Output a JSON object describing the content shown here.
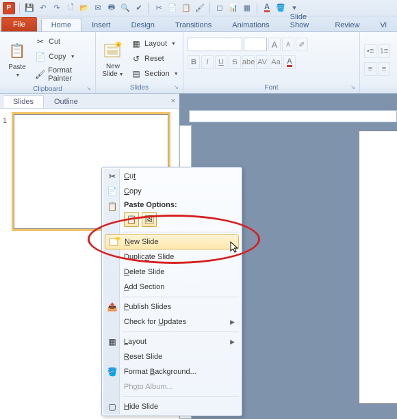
{
  "qat": {
    "app": "P"
  },
  "tabs": {
    "file": "File",
    "home": "Home",
    "insert": "Insert",
    "design": "Design",
    "transitions": "Transitions",
    "animations": "Animations",
    "slideshow": "Slide Show",
    "review": "Review",
    "view_partial": "Vi"
  },
  "ribbon": {
    "clipboard": {
      "paste": "Paste",
      "cut": "Cut",
      "copy": "Copy",
      "format_painter": "Format Painter",
      "group_name": "Clipboard"
    },
    "slides": {
      "new_slide": "New\nSlide",
      "layout": "Layout",
      "reset": "Reset",
      "section": "Section",
      "group_name": "Slides"
    },
    "font": {
      "group_name": "Font",
      "bold": "B",
      "italic": "I",
      "underline": "U",
      "strike": "S",
      "shadow": "abe",
      "spacing": "AV",
      "case": "Aa",
      "size_up": "A",
      "size_down": "A"
    }
  },
  "left_pane": {
    "tab_slides": "Slides",
    "tab_outline": "Outline",
    "slide_number": "1"
  },
  "context_menu": {
    "cut": "Cut",
    "copy": "Copy",
    "paste_options": "Paste Options:",
    "new_slide": "New Slide",
    "duplicate_slide": "Duplicate Slide",
    "delete_slide": "Delete Slide",
    "add_section": "Add Section",
    "publish_slides": "Publish Slides",
    "check_updates": "Check for Updates",
    "layout": "Layout",
    "reset_slide": "Reset Slide",
    "format_background": "Format Background...",
    "photo_album": "Photo Album...",
    "hide_slide": "Hide Slide"
  }
}
